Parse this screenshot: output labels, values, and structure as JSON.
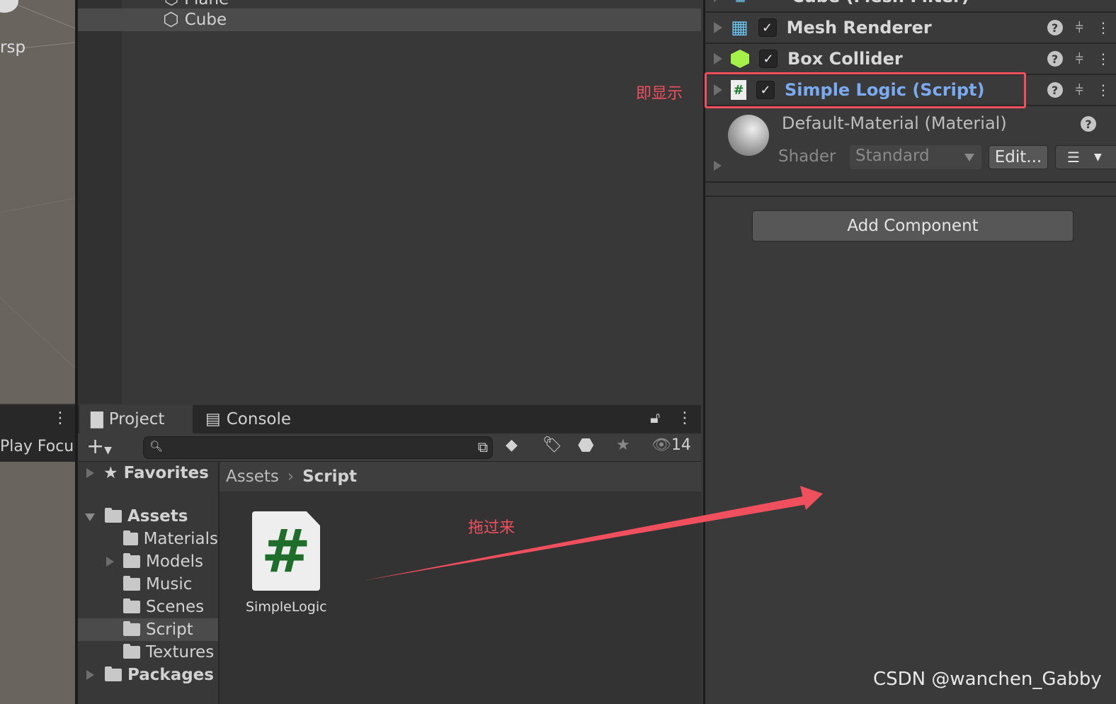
{
  "scene": {
    "label": "rsp",
    "play_focus": "Play Focu"
  },
  "hierarchy": {
    "items": [
      {
        "label": "Plane"
      },
      {
        "label": "Cube"
      }
    ]
  },
  "annotations": {
    "show_note": "即显示",
    "drag_note": "拖过来",
    "arrow_color": "#f0505e",
    "watermark": "CSDN @wanchen_Gabby"
  },
  "inspector": {
    "components": [
      {
        "name": "Cube (Mesh Filter)",
        "icon": "mesh-filter-icon"
      },
      {
        "name": "Mesh Renderer",
        "icon": "mesh-renderer-icon",
        "enabled": true
      },
      {
        "name": "Box Collider",
        "icon": "box-collider-icon",
        "enabled": true
      },
      {
        "name": "Simple Logic (Script)",
        "icon": "script-icon",
        "enabled": true,
        "highlight_color": "#7aaaf0"
      }
    ],
    "material": {
      "name": "Default-Material (Material)",
      "shader_label": "Shader",
      "shader_value": "Standard",
      "edit_label": "Edit..."
    },
    "add_component": "Add Component"
  },
  "project": {
    "tabs": [
      {
        "label": "Project",
        "active": true
      },
      {
        "label": "Console"
      }
    ],
    "search_placeholder": "",
    "hidden_count": "14",
    "tree": [
      {
        "label": "Favorites",
        "level": 0
      },
      {
        "label": "Assets",
        "level": 0,
        "expanded": true
      },
      {
        "label": "Materials",
        "level": 1
      },
      {
        "label": "Models",
        "level": 1
      },
      {
        "label": "Music",
        "level": 1
      },
      {
        "label": "Scenes",
        "level": 1
      },
      {
        "label": "Script",
        "level": 1,
        "selected": true
      },
      {
        "label": "Textures",
        "level": 1
      },
      {
        "label": "Packages",
        "level": 0
      }
    ],
    "breadcrumb": [
      "Assets",
      "Script"
    ],
    "assets": [
      {
        "label": "SimpleLogic",
        "icon": "csharp-script-icon"
      }
    ]
  }
}
